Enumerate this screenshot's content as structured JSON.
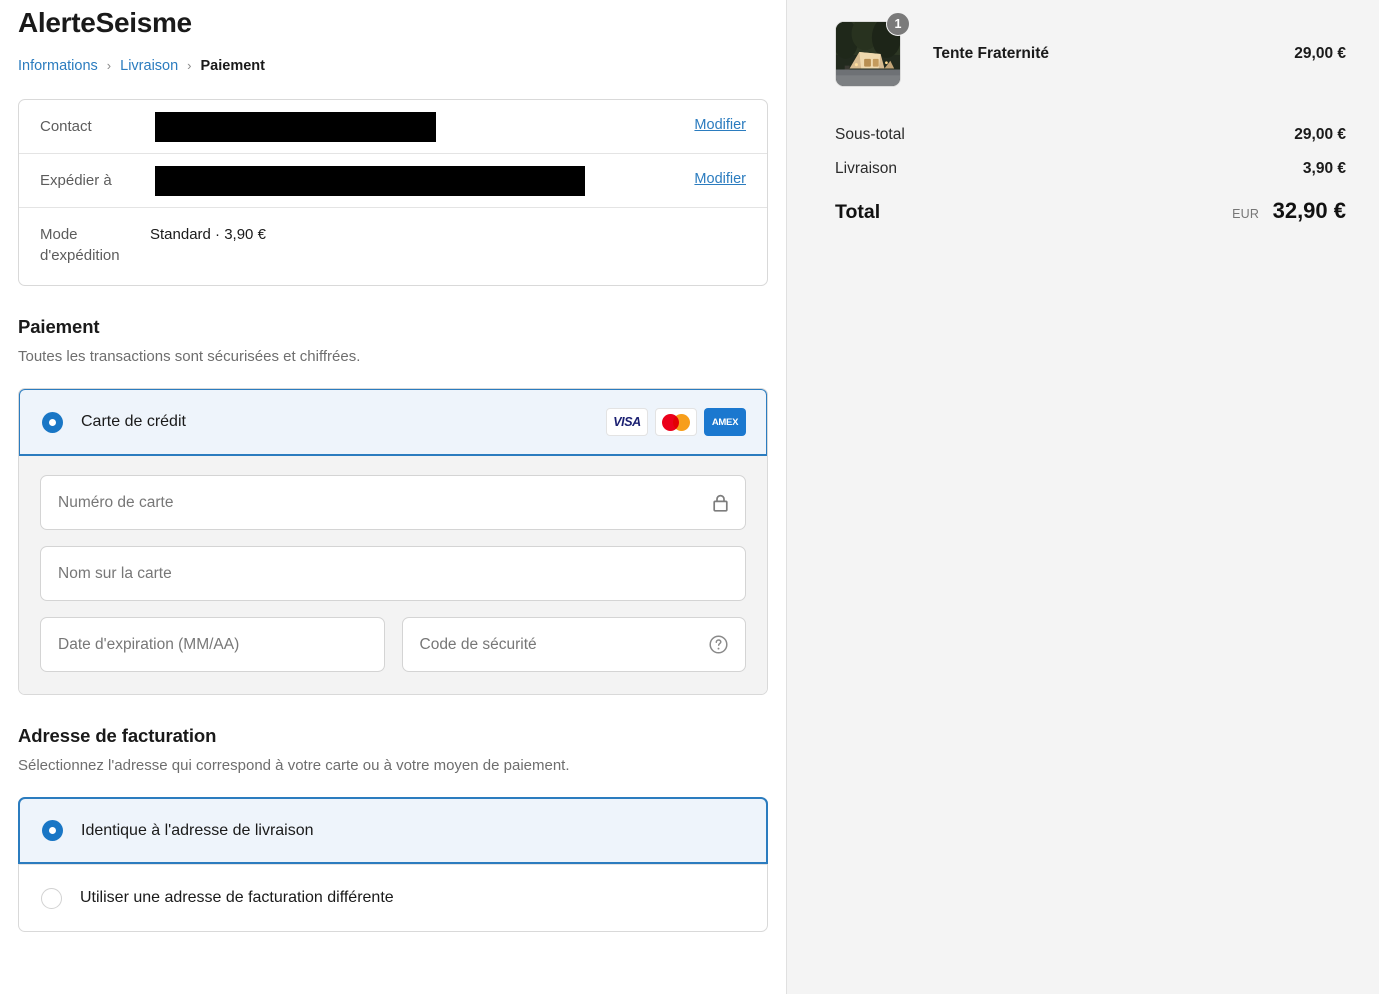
{
  "shop": {
    "title": "AlerteSeisme"
  },
  "breadcrumb": {
    "items": [
      {
        "label": "Informations",
        "state": "link"
      },
      {
        "label": "Livraison",
        "state": "link"
      },
      {
        "label": "Paiement",
        "state": "current"
      }
    ],
    "separator": "›"
  },
  "review": {
    "contact": {
      "label": "Contact",
      "value": "",
      "redacted": true,
      "action": "Modifier"
    },
    "ship_to": {
      "label": "Expédier à",
      "value": "",
      "redacted": true,
      "action": "Modifier"
    },
    "ship_mode": {
      "label": "Mode d'expédition",
      "value": "Standard · 3,90 €"
    }
  },
  "payment": {
    "heading": "Paiement",
    "subtitle": "Toutes les transactions sont sécurisées et chiffrées.",
    "method_label": "Carte de crédit",
    "method_selected": true,
    "brands": [
      {
        "name": "visa-logo",
        "text": "VISA"
      },
      {
        "name": "mastercard-logo",
        "text": ""
      },
      {
        "name": "amex-logo",
        "text": "AMEX"
      }
    ],
    "fields": {
      "card_number": {
        "placeholder": "Numéro de carte",
        "value": "",
        "icon": "lock-icon"
      },
      "card_name": {
        "placeholder": "Nom sur la carte",
        "value": ""
      },
      "expiry": {
        "placeholder": "Date d'expiration (MM/AA)",
        "value": ""
      },
      "cvv": {
        "placeholder": "Code de sécurité",
        "value": "",
        "icon": "help-circle-icon"
      }
    }
  },
  "billing": {
    "heading": "Adresse de facturation",
    "subtitle": "Sélectionnez l'adresse qui correspond à votre carte ou à votre moyen de paiement.",
    "options": [
      {
        "label": "Identique à l'adresse de livraison",
        "selected": true
      },
      {
        "label": "Utiliser une adresse de facturation différente",
        "selected": false
      }
    ]
  },
  "summary": {
    "item": {
      "name": "Tente Fraternité",
      "price": "29,00 €",
      "quantity": "1",
      "image_alt": "tent-thumbnail"
    },
    "lines": [
      {
        "label": "Sous-total",
        "value": "29,00 €"
      },
      {
        "label": "Livraison",
        "value": "3,90 €"
      }
    ],
    "total": {
      "label": "Total",
      "currency": "EUR",
      "value": "32,90 €"
    }
  },
  "colors": {
    "accent": "#2b7cbf",
    "link": "#2b7cbf",
    "selected_bg": "#eef4fb",
    "sidebar_bg": "#f4f4f4"
  }
}
